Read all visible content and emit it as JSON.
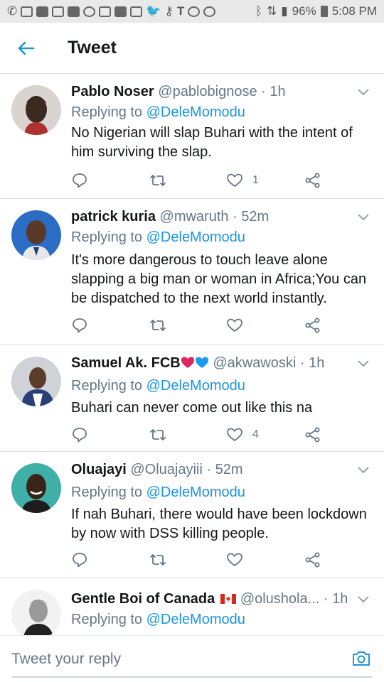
{
  "status_bar": {
    "battery": "96%",
    "time": "5:08 PM"
  },
  "header": {
    "title": "Tweet"
  },
  "composer": {
    "placeholder": "Tweet your reply"
  },
  "colors": {
    "accent": "#1b95e0",
    "secondary_text": "#657786",
    "divider": "#d8dde1"
  },
  "tweets": [
    {
      "name": "Pablo Noser",
      "handle": "@pablobignose",
      "time": "1h",
      "reply_label": "Replying to",
      "reply_to": "@DeleMomodu",
      "body": "No Nigerian will slap Buhari with the intent of him surviving the slap.",
      "likes": "1"
    },
    {
      "name": "patrick kuria",
      "handle": "@mwaruth",
      "time": "52m",
      "reply_label": "Replying to",
      "reply_to": "@DeleMomodu",
      "body": "It's more dangerous to touch leave alone slapping a big man or woman in Africa;You can be dispatched to the next world instantly.",
      "likes": ""
    },
    {
      "name": "Samuel Ak. FCB",
      "handle": "@akwawoski",
      "time": "1h",
      "reply_label": "Replying to",
      "reply_to": "@DeleMomodu",
      "body": "Buhari can never come out like this na",
      "likes": "4"
    },
    {
      "name": "Oluajayi",
      "handle": "@Oluajayiii",
      "time": "52m",
      "reply_label": "Replying to",
      "reply_to": "@DeleMomodu",
      "body": "If nah Buhari, there would have been lockdown by now with DSS killing people.",
      "likes": ""
    },
    {
      "name": "Gentle Boi of Canada",
      "handle": "@olushola...",
      "time": "1h",
      "reply_label": "Replying to",
      "reply_to": "@DeleMomodu",
      "body": "",
      "likes": ""
    }
  ],
  "dot": "·"
}
